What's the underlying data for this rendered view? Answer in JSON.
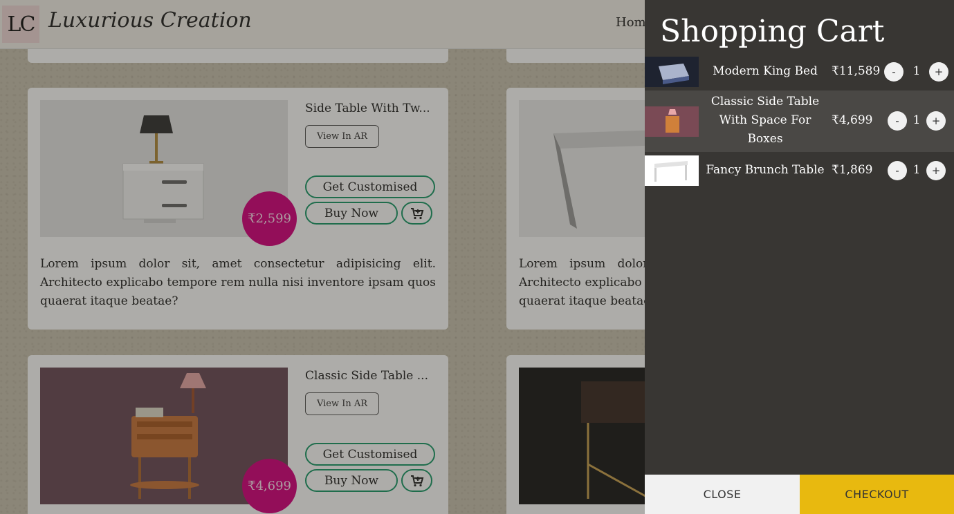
{
  "header": {
    "logo_text": "LC",
    "brand": "Luxurious Creation",
    "nav_home": "Home"
  },
  "products": [
    {
      "title": "Side Table With Tw...",
      "view_ar": "View In AR",
      "customise": "Get Customised",
      "buy": "Buy Now",
      "price": "₹2,599",
      "description": "Lorem ipsum dolor sit, amet consectetur adipisicing elit. Architecto explicabo tempore rem nulla nisi inventore ipsam quos quaerat itaque beatae?"
    },
    {
      "description": "Lorem ipsum dolor sit, amet consectetur adipisicing elit. Architecto explicabo tempore rem nulla nisi inventore ipsam quos quaerat itaque beatae?"
    },
    {
      "title": "Classic Side Table ...",
      "view_ar": "View In AR",
      "customise": "Get Customised",
      "buy": "Buy Now",
      "price": "₹4,699"
    }
  ],
  "cart": {
    "title": "Shopping Cart",
    "items": [
      {
        "name": "Modern King Bed",
        "price": "₹11,589",
        "qty": "1",
        "minus": "-",
        "plus": "+"
      },
      {
        "name": "Classic Side Table With Space For Boxes",
        "price": "₹4,699",
        "qty": "1",
        "minus": "-",
        "plus": "+"
      },
      {
        "name": "Fancy Brunch Table",
        "price": "₹1,869",
        "qty": "1",
        "minus": "-",
        "plus": "+"
      }
    ],
    "close_label": "CLOSE",
    "checkout_label": "CHECKOUT"
  },
  "colors": {
    "price_badge": "#d6007e",
    "button_border": "#1a9a6a",
    "drawer_bg": "#383633",
    "checkout_bg": "#e8b90f"
  },
  "icons": [
    "add-to-cart-icon"
  ]
}
